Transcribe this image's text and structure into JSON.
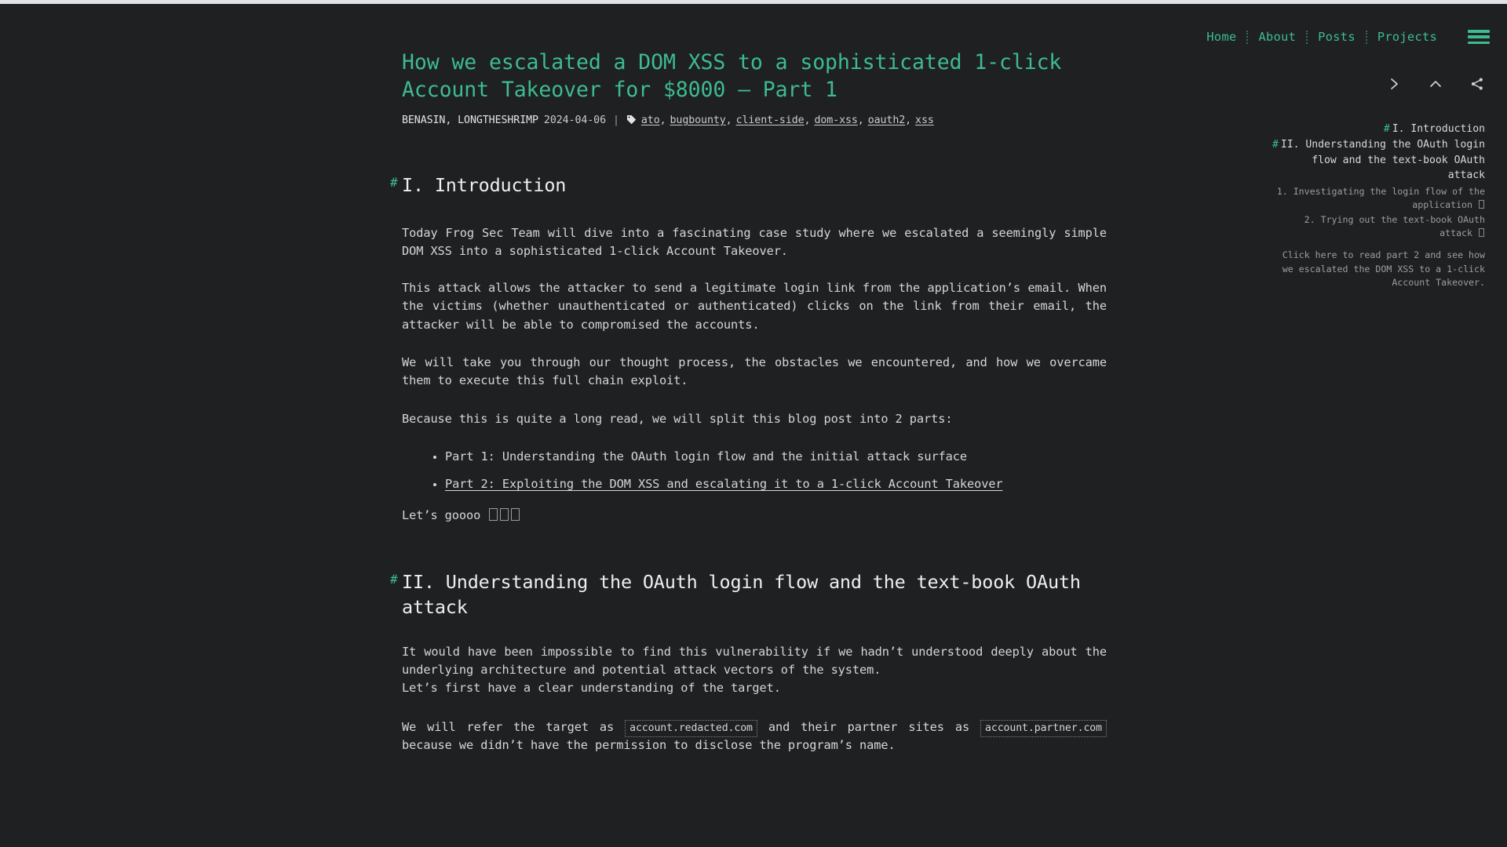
{
  "theme": {
    "background": "#1e2022",
    "accent_green": "#3ebb8f",
    "body_text": "#d4d6d8",
    "muted_text": "#9b9da0"
  },
  "nav": {
    "items": [
      {
        "label": "Home"
      },
      {
        "label": "About"
      },
      {
        "label": "Posts"
      },
      {
        "label": "Projects"
      }
    ],
    "menu_icon": "hamburger-icon"
  },
  "icon_row": [
    {
      "name": "chevron-right-icon"
    },
    {
      "name": "chevron-up-icon"
    },
    {
      "name": "share-icon"
    }
  ],
  "toc": {
    "entries": [
      {
        "level": 1,
        "hash": "#",
        "label": "I. Introduction"
      },
      {
        "level": 1,
        "hash": "#",
        "label": "II. Understanding the OAuth login flow and the text-book OAuth attack"
      },
      {
        "level": 2,
        "label": "1. Investigating the login flow of the application"
      },
      {
        "level": 2,
        "label": "2. Trying out the text-book OAuth attack"
      }
    ],
    "note": "Click here to read part 2 and see how we escalated the DOM XSS to a 1-click Account Takeover."
  },
  "post": {
    "title": "How we escalated a DOM XSS to a sophisticated 1-click Account Takeover for $8000 — Part 1",
    "authors": "BENASIN, LONGTHESHRIMP",
    "date": "2024-04-06",
    "separator": "|",
    "tag_icon": "tag-icon",
    "tags": [
      "ato",
      "bugbounty",
      "client-side",
      "dom-xss",
      "oauth2",
      "xss"
    ]
  },
  "sections": [
    {
      "anchor": "#",
      "heading": "I. Introduction",
      "paragraphs": [
        "Today Frog Sec Team will dive into a fascinating case study where we escalated a seemingly simple DOM XSS into a sophisticated 1-click Account Takeover.",
        "This attack allows the attacker to send a legitimate login link from the application’s email. When the victims (whether unauthenticated or authenticated) clicks on the link from their email, the attacker will be able to compromised the accounts.",
        "We will take you through our thought process, the obstacles we encountered, and how we overcame them to execute this full chain exploit.",
        "Because this is quite a long read, we will split this blog post into 2 parts:"
      ],
      "bullets": [
        {
          "text": "Part 1: Understanding the OAuth login flow and the initial attack surface",
          "link": false
        },
        {
          "text": "Part 2: Exploiting the DOM XSS and escalating it to a 1-click Account Takeover",
          "link": true
        }
      ],
      "closing": "Let’s goooo"
    },
    {
      "anchor": "#",
      "heading": "II. Understanding the OAuth login flow and the text-book OAuth attack",
      "para_a": "It would have been impossible to find this vulnerability if we hadn’t understood deeply about the underlying architecture and potential attack vectors of the system.",
      "para_b": "Let’s first have a clear understanding of the target.",
      "para_c_pre": "We will refer the target as",
      "para_c_code1": "account.redacted.com",
      "para_c_mid": "and their partner sites as",
      "para_c_code2": "account.partner.com",
      "para_c_post": "because we didn’t have the permission to disclose the program’s name."
    }
  ]
}
